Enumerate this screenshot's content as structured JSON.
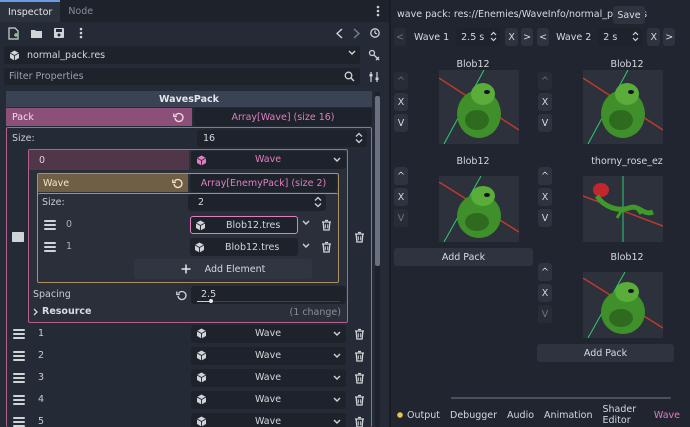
{
  "inspector": {
    "tabs": [
      {
        "label": "Inspector"
      },
      {
        "label": "Node"
      }
    ],
    "resource_path": "normal_pack.res",
    "filter_placeholder": "Filter Properties",
    "section_title": "WavesPack",
    "pack": {
      "label": "Pack",
      "value": "Array[Wave] (size 16)",
      "size_label": "Size:",
      "size_value": "16",
      "item0": {
        "index": "0",
        "type": "Wave",
        "wave_label": "Wave",
        "wave_value": "Array[EnemyPack] (size 2)",
        "inner_size_label": "Size:",
        "inner_size_value": "2",
        "entries": [
          {
            "index": "0",
            "value": "Blob12.tres"
          },
          {
            "index": "1",
            "value": "Blob12.tres"
          }
        ],
        "add_element": "Add Element",
        "spacing_label": "Spacing",
        "spacing_value": "2.5",
        "resource_label": "Resource",
        "resource_note": "(1 change)"
      },
      "items": [
        {
          "index": "1",
          "type": "Wave"
        },
        {
          "index": "2",
          "type": "Wave"
        },
        {
          "index": "3",
          "type": "Wave"
        },
        {
          "index": "4",
          "type": "Wave"
        },
        {
          "index": "5",
          "type": "Wave"
        }
      ]
    }
  },
  "wave_panel": {
    "title": "wave pack: res://Enemies/WaveInfo/normal_pack.res",
    "save_label": "Save",
    "waves": [
      {
        "label": "Wave 1",
        "time": "2.5 s"
      },
      {
        "label": "Wave 2",
        "time": "2 s"
      }
    ],
    "col1": {
      "cards": [
        {
          "name": "Blob12"
        },
        {
          "name": "Blob12"
        }
      ],
      "add_pack": "Add Pack"
    },
    "col2": {
      "cards": [
        {
          "name": "Blob12"
        },
        {
          "name": "thorny_rose_ez"
        },
        {
          "name": "Blob12"
        }
      ],
      "add_pack": "Add Pack"
    },
    "buttons": {
      "up": "^",
      "remove": "X",
      "down": "V",
      "prev": "<",
      "next": ">"
    }
  },
  "bottom_tabs": [
    {
      "label": "Output"
    },
    {
      "label": "Debugger"
    },
    {
      "label": "Audio"
    },
    {
      "label": "Animation"
    },
    {
      "label": "Shader Editor"
    },
    {
      "label": "Wave"
    }
  ],
  "colors": {
    "accent_pink": "#b5608e",
    "accent_gold": "#a89266",
    "active_tab_blue": "#699ce8",
    "wave_tab": "#e27cc2"
  }
}
